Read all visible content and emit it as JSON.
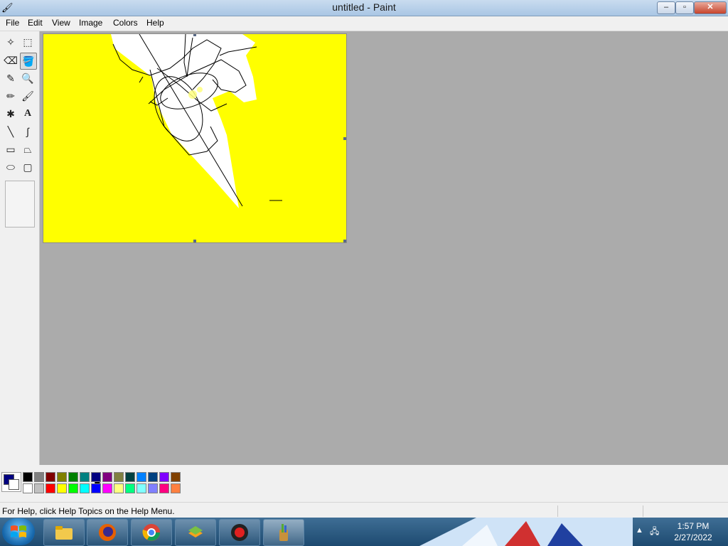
{
  "window": {
    "title": "untitled - Paint",
    "min": "–",
    "max": "▫",
    "close": "✕"
  },
  "menu": [
    "File",
    "Edit",
    "View",
    "Image",
    "Colors",
    "Help"
  ],
  "tools": [
    {
      "name": "free-form-select-icon",
      "glyph": "✧"
    },
    {
      "name": "rect-select-icon",
      "glyph": "⬚"
    },
    {
      "name": "eraser-icon",
      "glyph": "⌫"
    },
    {
      "name": "fill-icon",
      "glyph": "🪣"
    },
    {
      "name": "pick-color-icon",
      "glyph": "✎"
    },
    {
      "name": "magnifier-icon",
      "glyph": "🔍"
    },
    {
      "name": "pencil-icon",
      "glyph": "✏"
    },
    {
      "name": "brush-icon",
      "glyph": "🖌"
    },
    {
      "name": "airbrush-icon",
      "glyph": "✱"
    },
    {
      "name": "text-icon",
      "glyph": "A"
    },
    {
      "name": "line-icon",
      "glyph": "╲"
    },
    {
      "name": "curve-icon",
      "glyph": "∫"
    },
    {
      "name": "rectangle-icon",
      "glyph": "▭"
    },
    {
      "name": "polygon-icon",
      "glyph": "⏢"
    },
    {
      "name": "ellipse-icon",
      "glyph": "⬭"
    },
    {
      "name": "rounded-rect-icon",
      "glyph": "▢"
    }
  ],
  "selected_tool": 3,
  "palette_top": [
    "#000000",
    "#808080",
    "#800000",
    "#808000",
    "#008000",
    "#008080",
    "#000080",
    "#800080",
    "#808040",
    "#004040",
    "#0080ff",
    "#004080",
    "#8000ff",
    "#804000"
  ],
  "palette_bottom": [
    "#ffffff",
    "#c0c0c0",
    "#ff0000",
    "#ffff00",
    "#00ff00",
    "#00ffff",
    "#0000ff",
    "#ff00ff",
    "#ffff80",
    "#00ff80",
    "#80ffff",
    "#8080ff",
    "#ff0080",
    "#ff8040"
  ],
  "foreground_color": "#000080",
  "background_color": "#ffffff",
  "status": {
    "text": "For Help, click Help Topics on the Help Menu."
  },
  "clock": {
    "time": "1:57 PM",
    "date": "2/27/2022"
  },
  "taskbar_apps": [
    "folder-icon",
    "firefox-icon",
    "chrome-icon",
    "bluestacks-icon",
    "record-icon",
    "paint-icon"
  ]
}
